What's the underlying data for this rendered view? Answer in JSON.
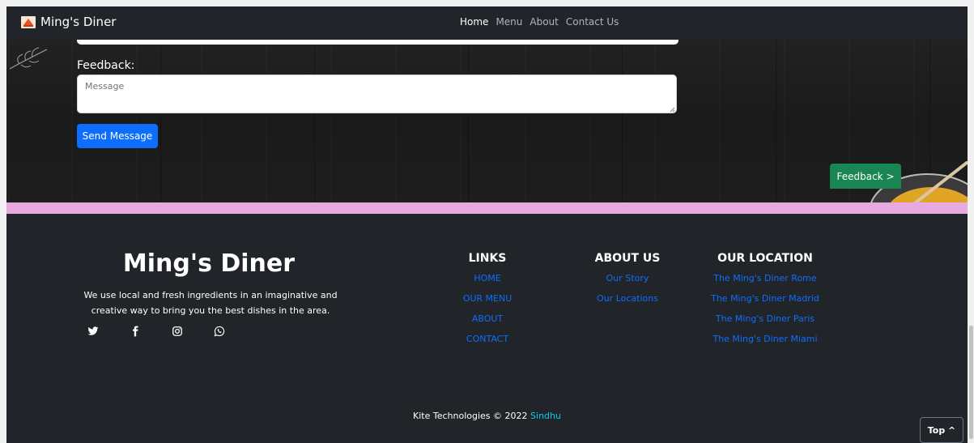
{
  "navbar": {
    "brand": "Ming's Diner",
    "links": [
      {
        "label": "Home",
        "active": true
      },
      {
        "label": "Menu",
        "active": false
      },
      {
        "label": "About",
        "active": false
      },
      {
        "label": "Contact Us",
        "active": false
      }
    ]
  },
  "contact": {
    "feedback_label": "Feedback:",
    "message_placeholder": "Message",
    "send_button": "Send Message",
    "feedback_tab": "Feedback >"
  },
  "footer": {
    "title": "Ming's Diner",
    "description": "We use local and fresh ingredients in an imaginative and creative way to bring you the best dishes in the area.",
    "social_icons": [
      "twitter-icon",
      "facebook-icon",
      "instagram-icon",
      "whatsapp-icon"
    ],
    "links": {
      "heading": "LINKS",
      "items": [
        "HOME",
        "OUR MENU",
        "ABOUT",
        "CONTACT"
      ]
    },
    "about": {
      "heading": "ABOUT US",
      "items": [
        "Our Story",
        "Our Locations"
      ]
    },
    "locations": {
      "heading": "OUR LOCATION",
      "items": [
        "The Ming's Diner Rome",
        "The Ming's Diner Madrid",
        "The Ming's Diner Paris",
        "The Ming's Diner Miami"
      ]
    },
    "copyright": "Kite Technologies © 2022",
    "author": "Sindhu",
    "top_button": "Top ^"
  },
  "colors": {
    "link_blue": "#0d6efd",
    "accent_pink": "#e8a8e0",
    "feedback_green": "#198754",
    "author_cyan": "#0dcaf0"
  }
}
